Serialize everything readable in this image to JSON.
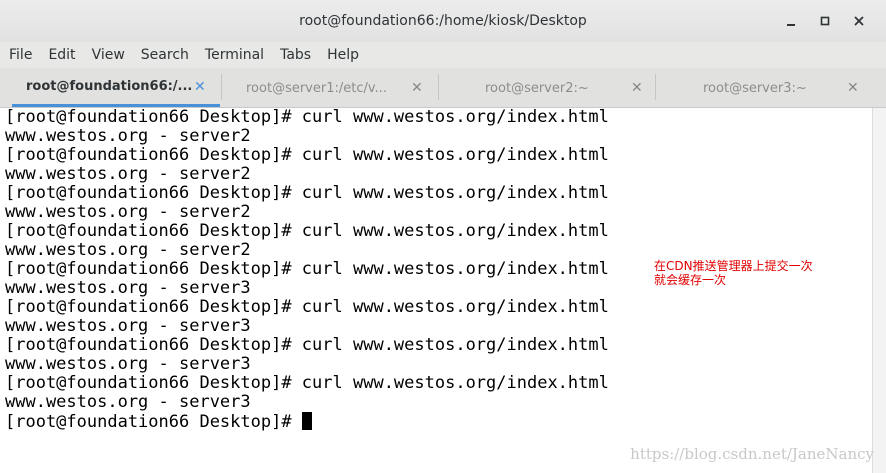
{
  "window": {
    "title": "root@foundation66:/home/kiosk/Desktop",
    "minimize_label": "–",
    "maximize_label": "□",
    "close_label": "✕"
  },
  "menu": [
    "File",
    "Edit",
    "View",
    "Search",
    "Terminal",
    "Tabs",
    "Help"
  ],
  "tabs": [
    {
      "label": "root@foundation66:/...",
      "active": true
    },
    {
      "label": "root@server1:/etc/v...",
      "active": false
    },
    {
      "label": "root@server2:~",
      "active": false
    },
    {
      "label": "root@server3:~",
      "active": false
    }
  ],
  "tab_close_glyph": "✕",
  "terminal": {
    "lines": [
      "[root@foundation66 Desktop]# curl www.westos.org/index.html",
      "www.westos.org - server2",
      "[root@foundation66 Desktop]# curl www.westos.org/index.html",
      "www.westos.org - server2",
      "[root@foundation66 Desktop]# curl www.westos.org/index.html",
      "www.westos.org - server2",
      "[root@foundation66 Desktop]# curl www.westos.org/index.html",
      "www.westos.org - server2",
      "[root@foundation66 Desktop]# curl www.westos.org/index.html",
      "www.westos.org - server3",
      "[root@foundation66 Desktop]# curl www.westos.org/index.html",
      "www.westos.org - server3",
      "[root@foundation66 Desktop]# curl www.westos.org/index.html",
      "www.westos.org - server3",
      "[root@foundation66 Desktop]# curl www.westos.org/index.html",
      "www.westos.org - server3"
    ],
    "prompt": "[root@foundation66 Desktop]# "
  },
  "annotation": {
    "line1": "在CDN推送管理器上提交一次",
    "line2": "就会缓存一次",
    "color": "#e00000"
  },
  "watermark": "https://blog.csdn.net/JaneNancy",
  "colors": {
    "accent": "#4a90d9",
    "terminal_bg": "#ffffff",
    "terminal_fg": "#000000"
  }
}
